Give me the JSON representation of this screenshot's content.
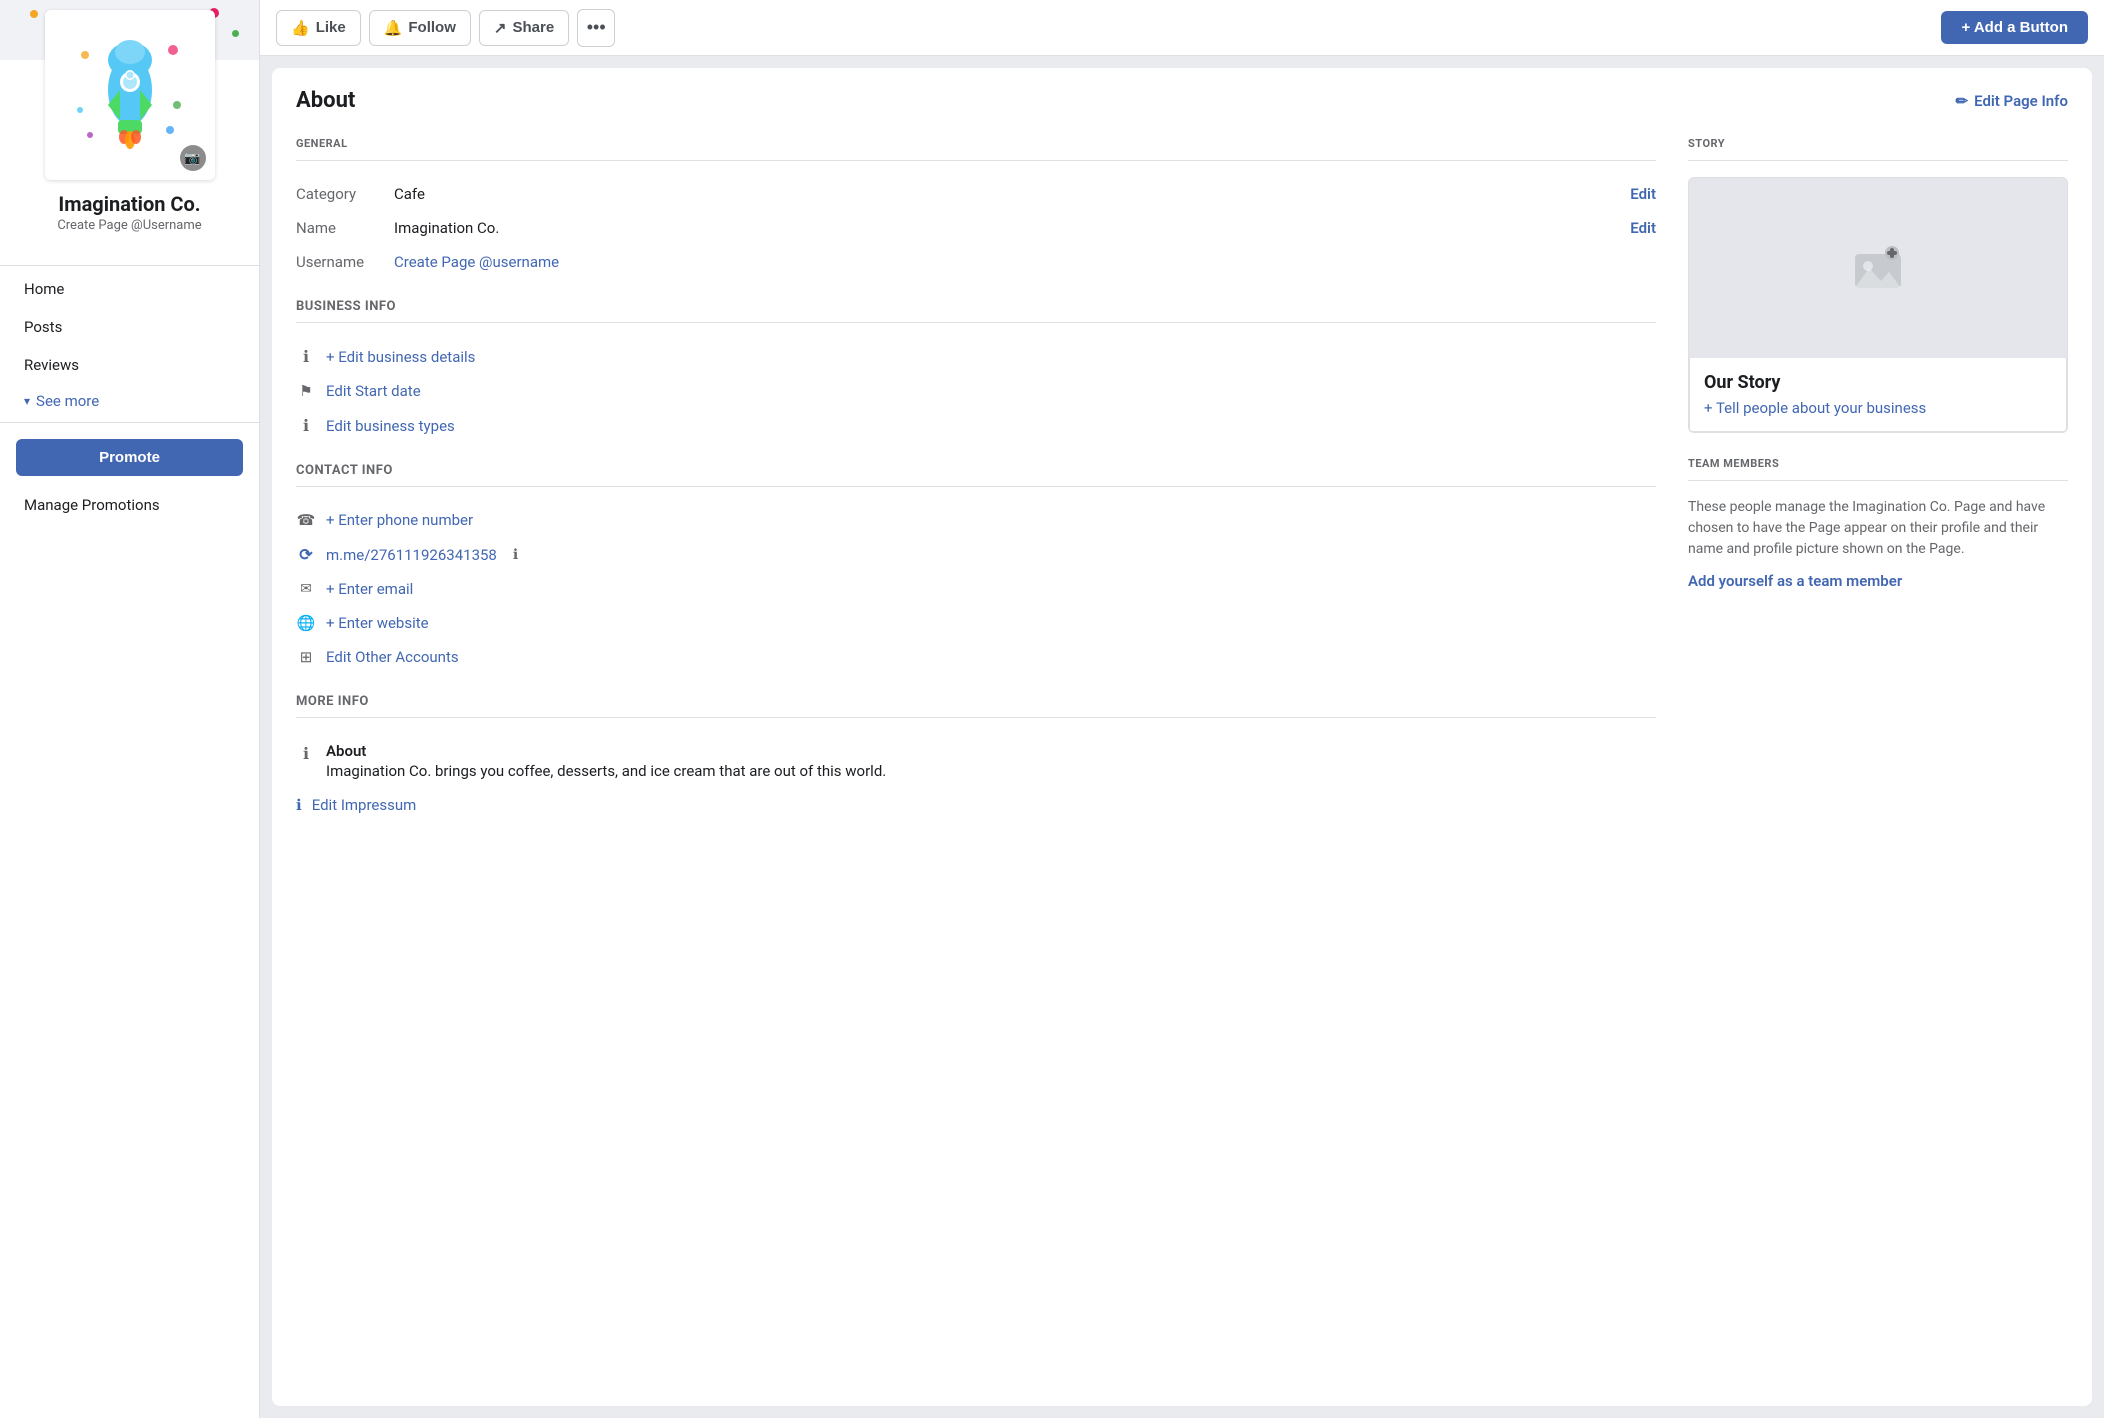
{
  "sidebar": {
    "page_name": "Imagination Co.",
    "page_username": "Create Page @Username",
    "nav_items": [
      {
        "label": "Home",
        "id": "home"
      },
      {
        "label": "Posts",
        "id": "posts"
      },
      {
        "label": "Reviews",
        "id": "reviews"
      }
    ],
    "see_more_label": "See more",
    "promote_label": "Promote",
    "manage_promotions_label": "Manage Promotions"
  },
  "topbar": {
    "like_label": "Like",
    "follow_label": "Follow",
    "share_label": "Share",
    "more_label": "•••",
    "add_button_label": "+ Add a Button"
  },
  "about": {
    "title": "About",
    "edit_page_info_label": "Edit Page Info",
    "general_section_label": "GENERAL",
    "category_label": "Category",
    "category_value": "Cafe",
    "category_edit": "Edit",
    "name_label": "Name",
    "name_value": "Imagination Co.",
    "name_edit": "Edit",
    "username_label": "Username",
    "username_link": "Create Page @username",
    "business_info_label": "BUSINESS INFO",
    "edit_business_details": "+ Edit business details",
    "edit_start_date": "Edit Start date",
    "edit_business_types": "Edit business types",
    "contact_info_label": "CONTACT INFO",
    "enter_phone": "+ Enter phone number",
    "messenger_link": "m.me/276111926341358",
    "enter_email": "+ Enter email",
    "enter_website": "+ Enter website",
    "edit_other_accounts": "Edit Other Accounts",
    "more_info_label": "MORE INFO",
    "about_label": "About",
    "about_value": "Imagination Co. brings you coffee, desserts, and ice cream that are out of this world.",
    "edit_impressum": "Edit Impressum"
  },
  "story": {
    "section_label": "STORY",
    "title": "Our Story",
    "tell_people_link": "+ Tell people about your business",
    "image_icon": "🖼"
  },
  "team_members": {
    "section_label": "TEAM MEMBERS",
    "description": "These people manage the Imagination Co. Page and have chosen to have the Page appear on their profile and their name and profile picture shown on the Page.",
    "add_yourself_link": "Add yourself as a team member"
  },
  "icons": {
    "pencil": "✏",
    "like_thumb": "👍",
    "follow_bell": "🔔",
    "share_arrow": "↗",
    "info_circle": "ℹ",
    "flag": "⚑",
    "phone": "📞",
    "messenger": "⟳",
    "email": "✉",
    "globe": "🌐",
    "grid": "⊞",
    "chevron_down": "▾",
    "camera": "📷",
    "plus": "+"
  },
  "colors": {
    "blue": "#4267b2",
    "light_gray": "#e4e6eb",
    "dark_text": "#1c1e21",
    "medium_text": "#65676b",
    "border": "#dddfe2",
    "bg": "#e9ebee"
  }
}
